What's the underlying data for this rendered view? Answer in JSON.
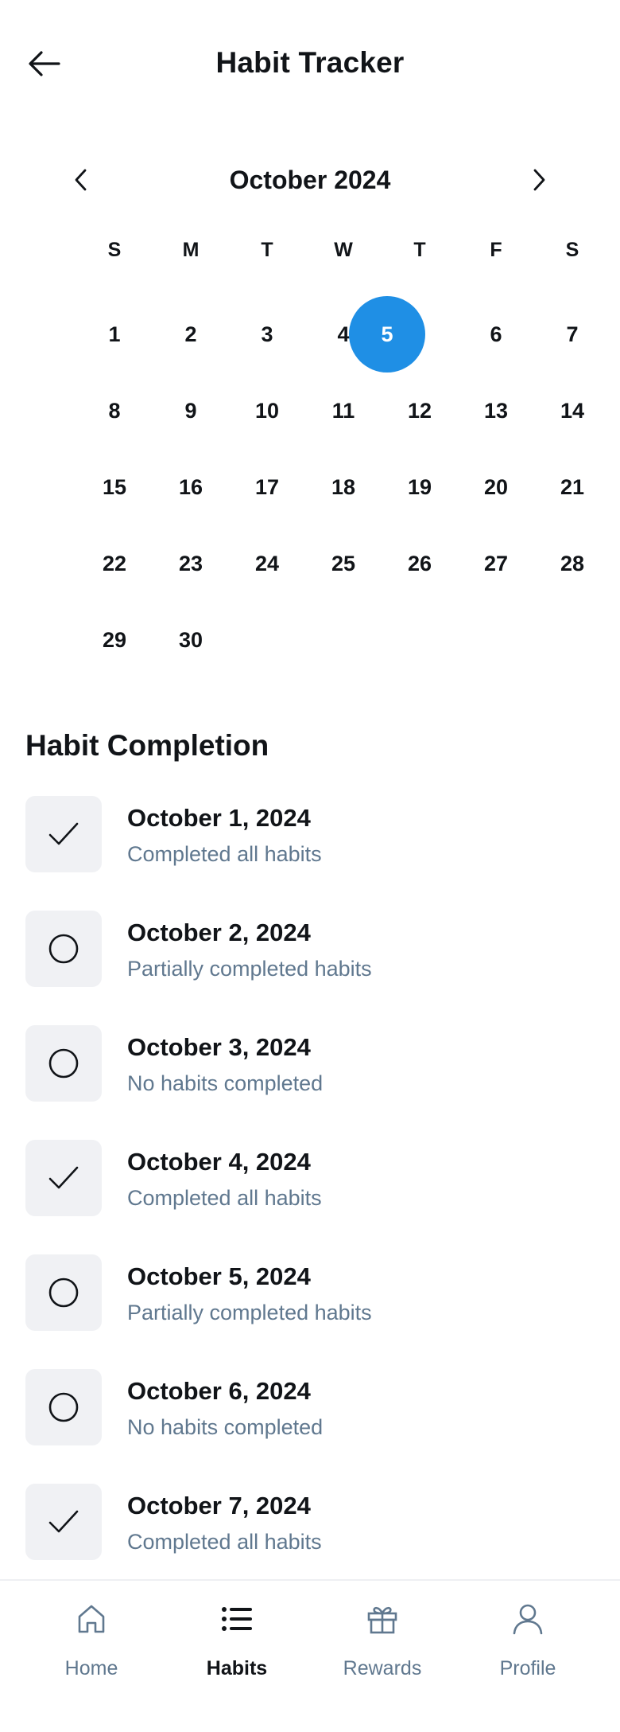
{
  "header": {
    "title": "Habit Tracker",
    "back_icon": "arrow-left-icon"
  },
  "calendar": {
    "month_label": "October 2024",
    "prev_icon": "chevron-left-icon",
    "next_icon": "chevron-right-icon",
    "weekdays": [
      "S",
      "M",
      "T",
      "W",
      "T",
      "F",
      "S"
    ],
    "weeks": [
      [
        "1",
        "2",
        "3",
        "4",
        "5",
        "6",
        "7"
      ],
      [
        "8",
        "9",
        "10",
        "11",
        "12",
        "13",
        "14"
      ],
      [
        "15",
        "16",
        "17",
        "18",
        "19",
        "20",
        "21"
      ],
      [
        "22",
        "23",
        "24",
        "25",
        "26",
        "27",
        "28"
      ],
      [
        "29",
        "30"
      ]
    ],
    "selected_day": "5",
    "selected_color": "#1f8fe5"
  },
  "completion": {
    "title": "Habit Completion",
    "items": [
      {
        "date": "October 1, 2024",
        "status": "Completed all habits",
        "icon": "check-icon"
      },
      {
        "date": "October 2, 2024",
        "status": "Partially completed habits",
        "icon": "circle-icon"
      },
      {
        "date": "October 3, 2024",
        "status": "No habits completed",
        "icon": "circle-icon"
      },
      {
        "date": "October 4, 2024",
        "status": "Completed all habits",
        "icon": "check-icon"
      },
      {
        "date": "October 5, 2024",
        "status": "Partially completed habits",
        "icon": "circle-icon"
      },
      {
        "date": "October 6, 2024",
        "status": "No habits completed",
        "icon": "circle-icon"
      },
      {
        "date": "October 7, 2024",
        "status": "Completed all habits",
        "icon": "check-icon"
      }
    ]
  },
  "bottom_nav": {
    "items": [
      {
        "label": "Home",
        "icon": "home-icon",
        "active": false
      },
      {
        "label": "Habits",
        "icon": "list-icon",
        "active": true
      },
      {
        "label": "Rewards",
        "icon": "gift-icon",
        "active": false
      },
      {
        "label": "Profile",
        "icon": "user-icon",
        "active": false
      }
    ]
  }
}
